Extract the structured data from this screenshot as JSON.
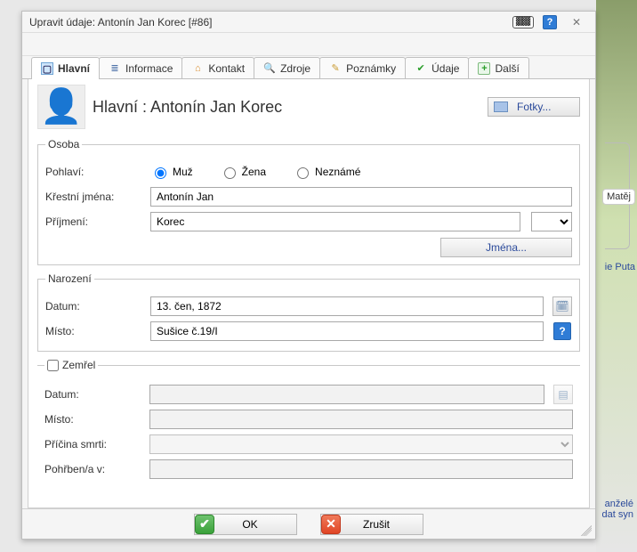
{
  "titlebar": {
    "title": "Upravit údaje: Antonín Jan Korec [#86]"
  },
  "tabs": [
    {
      "label": "Hlavní"
    },
    {
      "label": "Informace"
    },
    {
      "label": "Kontakt"
    },
    {
      "label": "Zdroje"
    },
    {
      "label": "Poznámky"
    },
    {
      "label": "Údaje"
    },
    {
      "label": "Další"
    }
  ],
  "header": {
    "title": "Hlavní : Antonín Jan Korec",
    "fotky_button": "Fotky..."
  },
  "person_section": {
    "legend": "Osoba",
    "gender_label": "Pohlaví:",
    "gender_options": {
      "male": "Muž",
      "female": "Žena",
      "unknown": "Neznámé"
    },
    "gender_value": "male",
    "given_label": "Křestní jména:",
    "given_value": "Antonín Jan",
    "surname_label": "Příjmení:",
    "surname_value": "Korec",
    "names_button": "Jména..."
  },
  "birth_section": {
    "legend": "Narození",
    "date_label": "Datum:",
    "date_value": "13. čen, 1872",
    "place_label": "Místo:",
    "place_value": "Sušice č.19/I"
  },
  "death_section": {
    "legend": "Zemřel",
    "checked": false,
    "date_label": "Datum:",
    "date_value": "",
    "place_label": "Místo:",
    "place_value": "",
    "cause_label": "Příčina smrti:",
    "cause_value": "",
    "burial_label": "Pohřben/a v:",
    "burial_value": ""
  },
  "footer": {
    "ok": "OK",
    "cancel": "Zrušit"
  },
  "bg": {
    "matej": "Matěj",
    "puta": "ie Puta",
    "bottom": "anželé\ndat syn"
  }
}
